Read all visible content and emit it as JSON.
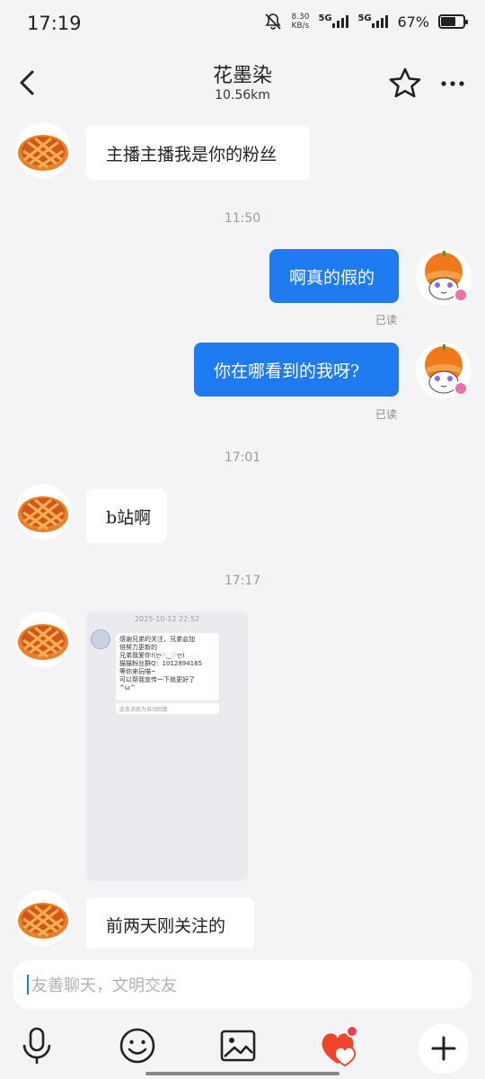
{
  "status_bar": {
    "time": "17:19",
    "net_speed_value": "8.30",
    "net_speed_unit": "KB/s",
    "sim1": "5G",
    "sim2": "5G",
    "battery_percent": "67%",
    "battery_level": 0.67
  },
  "header": {
    "title": "花墨染",
    "distance": "10.56km",
    "back_icon": "chevron-left-icon",
    "star_icon": "star-outline-icon",
    "more_icon": "more-dots-icon"
  },
  "messages": [
    {
      "type": "incoming",
      "text": "主播主播我是你的粉丝"
    },
    {
      "type": "timestamp",
      "text": "11:50"
    },
    {
      "type": "outgoing",
      "text": "啊真的假的",
      "read": "已读"
    },
    {
      "type": "outgoing",
      "text": "你在哪看到的我呀?",
      "read": "已读"
    },
    {
      "type": "timestamp",
      "text": "17:01"
    },
    {
      "type": "incoming",
      "text": "b站啊"
    },
    {
      "type": "timestamp",
      "text": "17:17"
    },
    {
      "type": "incoming-image",
      "date": "2025-10-12 22:52",
      "lines": [
        "感谢兄弟的关注，兄弟会加",
        "倍努力更新的",
        "兄弟我爱你!(ღ♡‿♡ღ)",
        "猫猫粉丝群Q：1012894165",
        "等你来玩喵~",
        "可以帮我宣传一下就更好了",
        "^ω^"
      ],
      "footer": "此条消息为自动回复"
    },
    {
      "type": "incoming",
      "text": "前两天刚关注的"
    }
  ],
  "input": {
    "placeholder": "友善聊天，文明交友"
  },
  "toolbar": {
    "icons": [
      "microphone-icon",
      "emoji-icon",
      "image-icon",
      "gift-heart-icon",
      "plus-icon"
    ]
  },
  "colors": {
    "accent": "#1f7bf2",
    "background": "#f4f4f6",
    "bubble_in": "#ffffff",
    "badge_pink": "#f06fa8"
  }
}
